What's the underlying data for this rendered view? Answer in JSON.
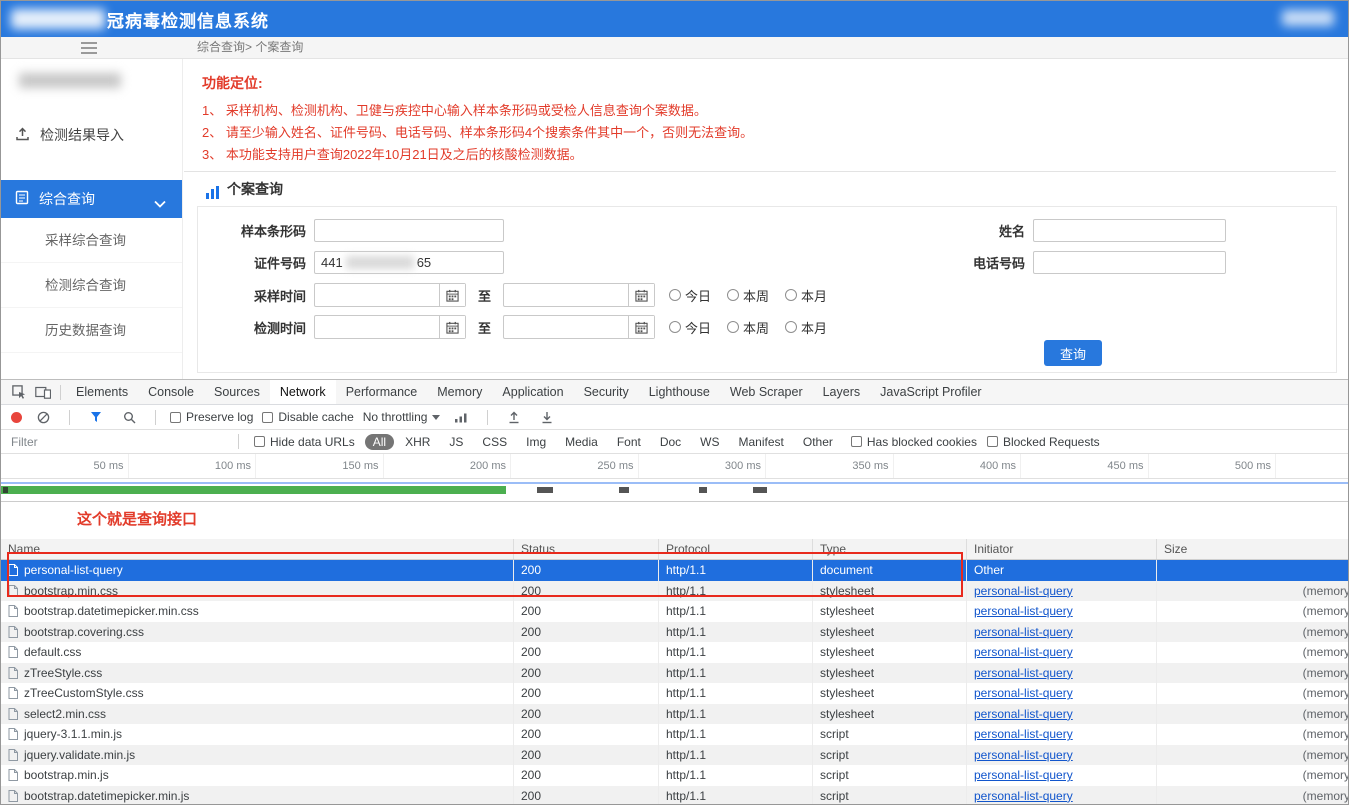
{
  "colors": {
    "accent": "#2878dd",
    "selected": "#1f6ede",
    "red": "#e23b2a",
    "link": "#1155cc",
    "green": "#4caf50"
  },
  "header": {
    "title": "冠病毒检测信息系统"
  },
  "breadcrumb": "综合查询> 个案查询",
  "sidebar": {
    "import_item": "检测结果导入",
    "query_item": "综合查询",
    "sub_items": [
      "采样综合查询",
      "检测综合查询",
      "历史数据查询"
    ]
  },
  "notice": {
    "title": "功能定位:",
    "lines": [
      "1、 采样机构、检测机构、卫健与疾控中心输入样本条形码或受检人信息查询个案数据。",
      "2、 请至少输入姓名、证件号码、电话号码、样本条形码4个搜索条件其中一个，否则无法查询。",
      "3、 本功能支持用户查询2022年10月21日及之后的核酸检测数据。"
    ]
  },
  "form": {
    "tab_title": "个案查询",
    "barcode_label": "样本条形码",
    "name_label": "姓名",
    "id_label": "证件号码",
    "id_prefix": "441",
    "id_suffix": "65",
    "phone_label": "电话号码",
    "sample_time_label": "采样时间",
    "test_time_label": "检测时间",
    "to_label": "至",
    "radios": [
      "今日",
      "本周",
      "本月"
    ],
    "query_button": "查询"
  },
  "devtools": {
    "tabs": [
      {
        "label": "Elements"
      },
      {
        "label": "Console"
      },
      {
        "label": "Sources"
      },
      {
        "label": "Network",
        "active": true
      },
      {
        "label": "Performance"
      },
      {
        "label": "Memory"
      },
      {
        "label": "Application"
      },
      {
        "label": "Security"
      },
      {
        "label": "Lighthouse"
      },
      {
        "label": "Web Scraper"
      },
      {
        "label": "Layers"
      },
      {
        "label": "JavaScript Profiler"
      }
    ],
    "toolbar": {
      "preserve_log": "Preserve log",
      "disable_cache": "Disable cache",
      "throttling": "No throttling"
    },
    "filter": {
      "placeholder": "Filter",
      "hide_data_urls": "Hide data URLs",
      "pills": [
        {
          "label": "All",
          "active": true
        },
        {
          "label": "XHR"
        },
        {
          "label": "JS"
        },
        {
          "label": "CSS"
        },
        {
          "label": "Img"
        },
        {
          "label": "Media"
        },
        {
          "label": "Font"
        },
        {
          "label": "Doc"
        },
        {
          "label": "WS"
        },
        {
          "label": "Manifest"
        },
        {
          "label": "Other"
        }
      ],
      "has_blocked_cookies": "Has blocked cookies",
      "blocked_requests": "Blocked Requests"
    },
    "timeline_ticks": [
      "50 ms",
      "100 ms",
      "150 ms",
      "200 ms",
      "250 ms",
      "300 ms",
      "350 ms",
      "400 ms",
      "450 ms",
      "500 ms"
    ],
    "annotation": "这个就是查询接口",
    "table": {
      "columns": [
        "Name",
        "Status",
        "Protocol",
        "Type",
        "Initiator",
        "Size"
      ],
      "rows": [
        {
          "name": "personal-list-query",
          "status": "200",
          "protocol": "http/1.1",
          "type": "document",
          "initiator": "Other",
          "size": "",
          "selected": true,
          "initiator_link": false
        },
        {
          "name": "bootstrap.min.css",
          "status": "200",
          "protocol": "http/1.1",
          "type": "stylesheet",
          "initiator": "personal-list-query",
          "size": "(memory",
          "initiator_link": true
        },
        {
          "name": "bootstrap.datetimepicker.min.css",
          "status": "200",
          "protocol": "http/1.1",
          "type": "stylesheet",
          "initiator": "personal-list-query",
          "size": "(memory",
          "initiator_link": true
        },
        {
          "name": "bootstrap.covering.css",
          "status": "200",
          "protocol": "http/1.1",
          "type": "stylesheet",
          "initiator": "personal-list-query",
          "size": "(memory",
          "initiator_link": true
        },
        {
          "name": "default.css",
          "status": "200",
          "protocol": "http/1.1",
          "type": "stylesheet",
          "initiator": "personal-list-query",
          "size": "(memory",
          "initiator_link": true
        },
        {
          "name": "zTreeStyle.css",
          "status": "200",
          "protocol": "http/1.1",
          "type": "stylesheet",
          "initiator": "personal-list-query",
          "size": "(memory",
          "initiator_link": true
        },
        {
          "name": "zTreeCustomStyle.css",
          "status": "200",
          "protocol": "http/1.1",
          "type": "stylesheet",
          "initiator": "personal-list-query",
          "size": "(memory",
          "initiator_link": true
        },
        {
          "name": "select2.min.css",
          "status": "200",
          "protocol": "http/1.1",
          "type": "stylesheet",
          "initiator": "personal-list-query",
          "size": "(memory",
          "initiator_link": true
        },
        {
          "name": "jquery-3.1.1.min.js",
          "status": "200",
          "protocol": "http/1.1",
          "type": "script",
          "initiator": "personal-list-query",
          "size": "(memory",
          "initiator_link": true
        },
        {
          "name": "jquery.validate.min.js",
          "status": "200",
          "protocol": "http/1.1",
          "type": "script",
          "initiator": "personal-list-query",
          "size": "(memory",
          "initiator_link": true
        },
        {
          "name": "bootstrap.min.js",
          "status": "200",
          "protocol": "http/1.1",
          "type": "script",
          "initiator": "personal-list-query",
          "size": "(memory",
          "initiator_link": true
        },
        {
          "name": "bootstrap.datetimepicker.min.js",
          "status": "200",
          "protocol": "http/1.1",
          "type": "script",
          "initiator": "personal-list-query",
          "size": "(memory",
          "initiator_link": true
        }
      ]
    }
  },
  "icons": {
    "menu-icon": "three-bars",
    "import-icon": "upload-arrow",
    "query-icon": "document-lines",
    "chevron-down-icon": "chevron",
    "bar-chart-icon": "blue-bars",
    "calendar-icon": "calendar-grid",
    "record-icon": "red-dot",
    "clear-icon": "circle-slash",
    "filter-icon": "funnel",
    "search-icon": "magnifier",
    "inspect-icon": "cursor-box",
    "device-toolbar-icon": "phone-tablet",
    "network-conditions-icon": "signal-bars",
    "import-har-icon": "arrow-up",
    "export-har-icon": "arrow-down",
    "file-icon": "page-with-fold",
    "dropdown-arrow-icon": "triangle-down"
  }
}
